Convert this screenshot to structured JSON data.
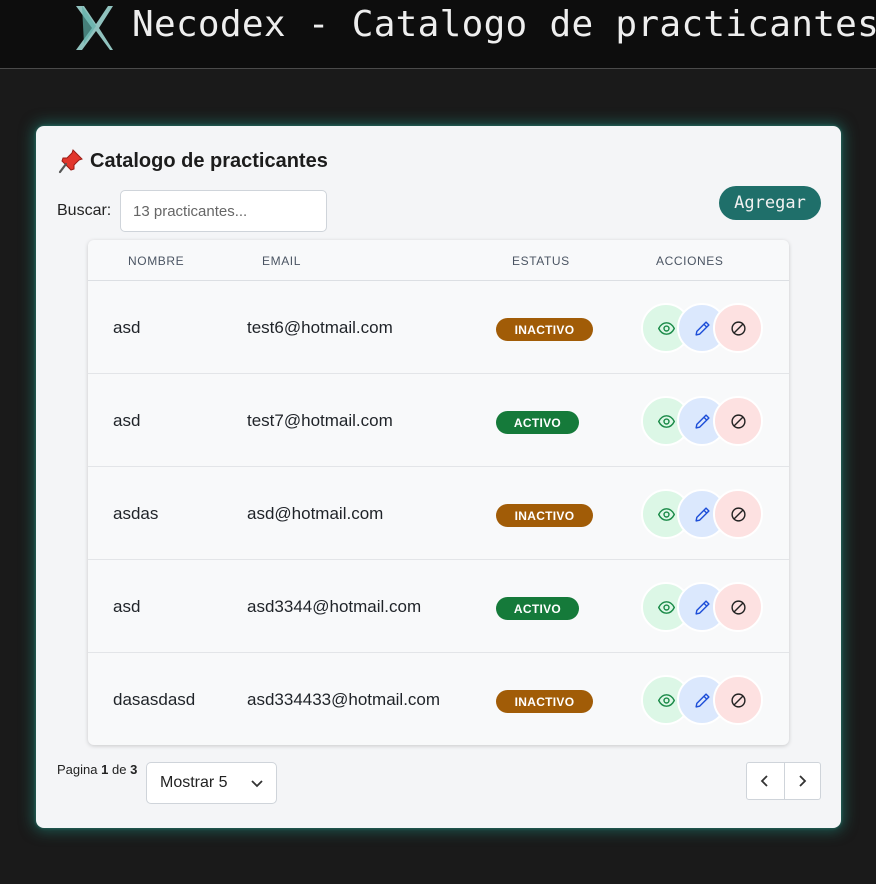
{
  "header": {
    "app_title": "Necodex - Catalogo de practicantes",
    "logo_icon": "necodex-x-logo"
  },
  "card": {
    "title": "Catalogo de practicantes",
    "title_icon": "pushpin-icon",
    "search_label": "Buscar:",
    "search_placeholder": "13 practicantes...",
    "add_label": "Agregar"
  },
  "table": {
    "columns": [
      "NOMBRE",
      "EMAIL",
      "ESTATUS",
      "ACCIONES"
    ],
    "rows": [
      {
        "name": "asd",
        "email": "test6@hotmail.com",
        "status": "INACTIVO"
      },
      {
        "name": "asd",
        "email": "test7@hotmail.com",
        "status": "ACTIVO"
      },
      {
        "name": "asdas",
        "email": "asd@hotmail.com",
        "status": "INACTIVO"
      },
      {
        "name": "asd",
        "email": "asd3344@hotmail.com",
        "status": "ACTIVO"
      },
      {
        "name": "dasasdasd",
        "email": "asd334433@hotmail.com",
        "status": "INACTIVO"
      }
    ],
    "action_icons": [
      "eye-icon",
      "pencil-icon",
      "disable-icon"
    ]
  },
  "pagination": {
    "page_label": "Pagina",
    "current_page": "1",
    "of_label": "de",
    "total_pages": "3",
    "page_size_label": "Mostrar 5"
  },
  "colors": {
    "accent": "#1f6f6a",
    "active": "#157a3a",
    "inactive": "#a15c07",
    "glow": "#208c7d"
  }
}
